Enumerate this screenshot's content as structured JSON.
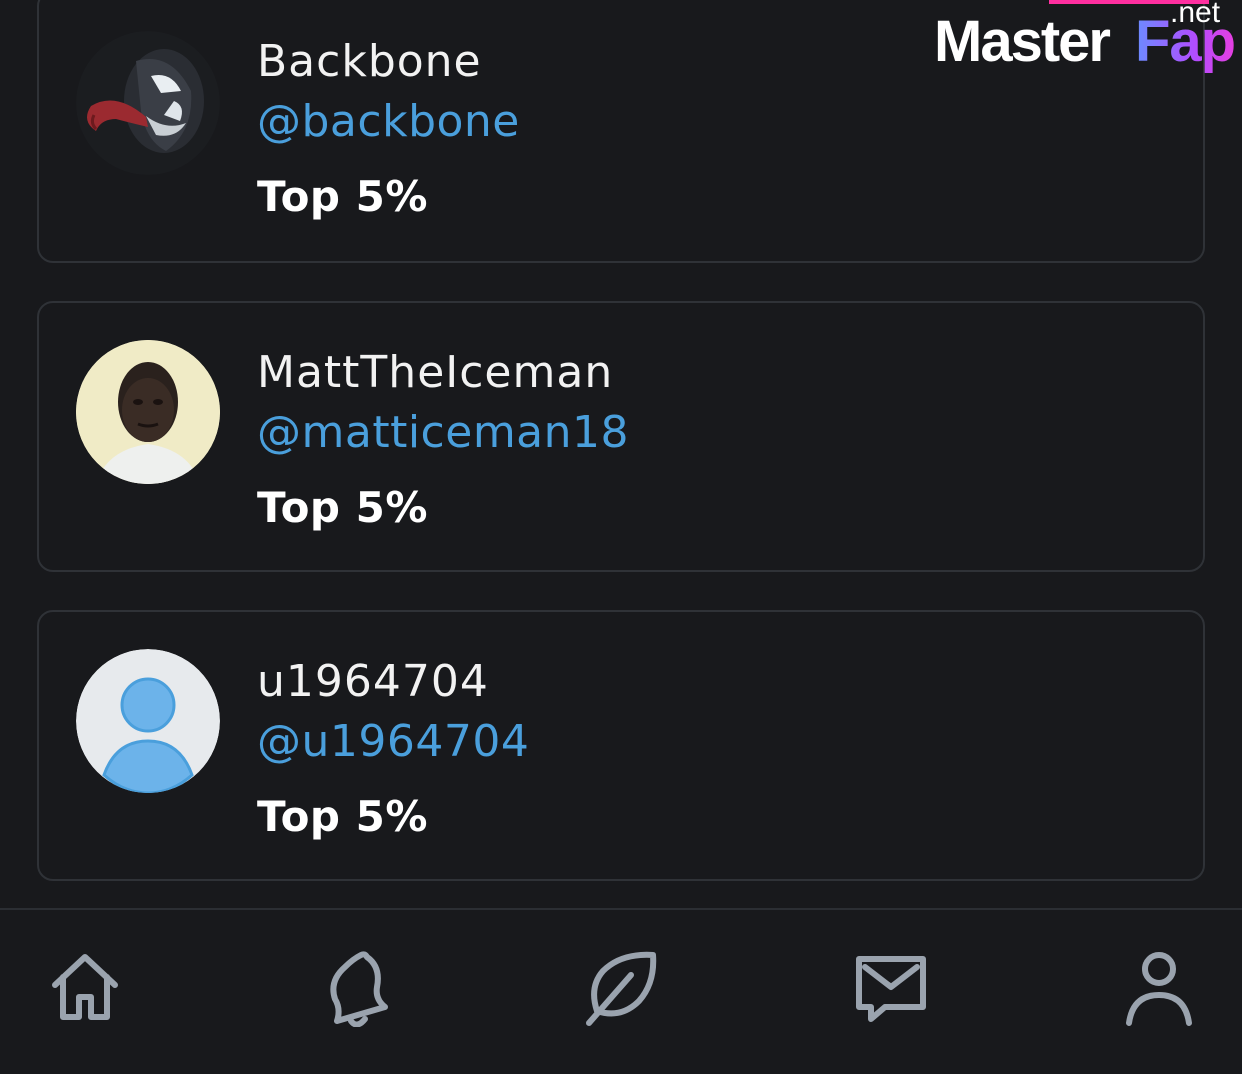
{
  "users": [
    {
      "name": "Backbone",
      "handle": "@backbone",
      "rank": "Top 5%",
      "avatar": "venom-avatar"
    },
    {
      "name": "MattTheIceman",
      "handle": "@matticeman18",
      "rank": "Top 5%",
      "avatar": "photo-avatar"
    },
    {
      "name": "u1964704",
      "handle": "@u1964704",
      "rank": "Top 5%",
      "avatar": "default-user-avatar"
    }
  ],
  "nav": [
    {
      "label": "home",
      "icon": "home-icon"
    },
    {
      "label": "notifications",
      "icon": "bell-icon"
    },
    {
      "label": "explore",
      "icon": "leaf-icon"
    },
    {
      "label": "messages",
      "icon": "message-icon"
    },
    {
      "label": "profile",
      "icon": "user-icon"
    }
  ],
  "watermark": {
    "master": "Master",
    "fap": "Fap",
    "net": ".net"
  },
  "colors": {
    "background": "#18191c",
    "handle": "#4a9fdc",
    "border": "#2f3237",
    "icon": "#9aa3ae"
  }
}
